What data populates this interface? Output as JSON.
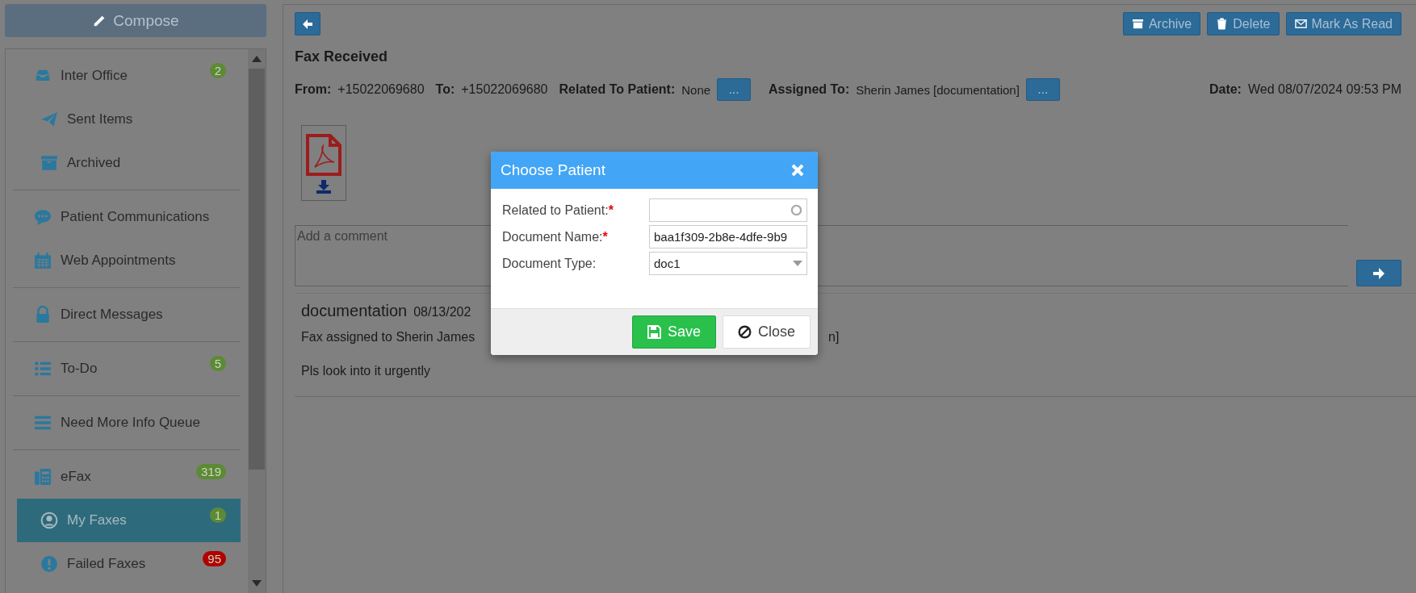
{
  "sidebar": {
    "compose_button": "Compose",
    "groups": [
      {
        "items": [
          {
            "label": "Inter Office",
            "selected": false,
            "badge": {
              "text": "2",
              "color": "#5d8a35"
            },
            "children": [
              {
                "label": "Sent Items",
                "selected": false
              },
              {
                "label": "Archived",
                "selected": false
              }
            ]
          }
        ]
      },
      {
        "items": [
          {
            "label": "Patient Communications",
            "selected": false
          },
          {
            "label": "Web Appointments",
            "selected": false
          }
        ]
      },
      {
        "items": [
          {
            "label": "Direct Messages",
            "selected": false
          }
        ]
      },
      {
        "items": [
          {
            "label": "To-Do",
            "selected": false,
            "badge": {
              "text": "5",
              "color": "#5d8a35"
            }
          }
        ]
      },
      {
        "items": [
          {
            "label": "Need More Info Queue",
            "selected": false
          }
        ]
      },
      {
        "items": [
          {
            "label": "eFax",
            "selected": false,
            "badge": {
              "text": "319",
              "color": "#5d8a35"
            },
            "children": [
              {
                "label": "My Faxes",
                "selected": true,
                "badge": {
                  "text": "1",
                  "color": "#5d8a35"
                }
              },
              {
                "label": "Failed Faxes",
                "selected": false,
                "badge": {
                  "text": "95",
                  "color": "#b00000"
                }
              }
            ]
          }
        ]
      }
    ]
  },
  "message": {
    "toolbar": [
      "Archive",
      "Delete",
      "Mark As Read"
    ],
    "title": "Fax Received",
    "fields": [
      {
        "kind": "text",
        "label": "From:",
        "value": "+15022069680"
      },
      {
        "kind": "text",
        "label": "To:",
        "value": "+15022069680"
      },
      {
        "kind": "picker",
        "label": "Related To Patient:",
        "value": "None",
        "button": "..."
      },
      {
        "kind": "picker",
        "label": "Assigned To:",
        "value": "Sherin James [documentation]",
        "button": "..."
      }
    ],
    "date": {
      "label": "Date:",
      "value": "Wed 08/07/2024 09:53 PM"
    },
    "comment_box": {
      "placeholder": "Add a comment"
    },
    "comments": [
      {
        "author": "documentation",
        "date": "08/13/202",
        "lines": [
          [
            "Fax assigned to Sherin James",
            "n]"
          ],
          [
            "Pls look into it urgently"
          ]
        ]
      }
    ]
  },
  "dialog": {
    "title": "Choose Patient",
    "fields": [
      {
        "kind": "search",
        "label": "Related to Patient:",
        "marker": "*"
      },
      {
        "kind": "text",
        "label": "Document Name:",
        "marker": "*",
        "value": "baa1f309-2b8e-4dfe-9b9"
      },
      {
        "kind": "select",
        "label": "Document Type:",
        "value": "doc1"
      }
    ],
    "buttons": [
      {
        "kind": "primary",
        "label": "Save"
      },
      {
        "kind": "default",
        "label": "Close"
      }
    ]
  }
}
